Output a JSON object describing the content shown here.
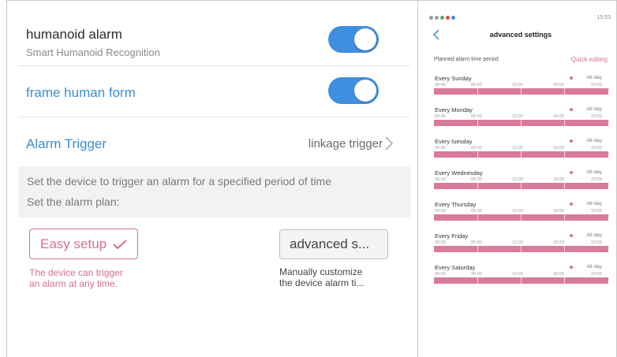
{
  "left": {
    "humanoid_alarm": {
      "title": "humanoid alarm",
      "subtitle": "Smart Humanoid Recognition",
      "enabled": true
    },
    "frame_human_form": {
      "title": "frame human form",
      "enabled": true
    },
    "alarm_trigger": {
      "title": "Alarm Trigger",
      "value": "linkage trigger"
    },
    "info": {
      "line1": "Set the device to trigger an alarm for a specified period of time",
      "line2": "Set the alarm plan:"
    },
    "easy_setup": {
      "label": "Easy setup",
      "desc_line1": "The device can trigger",
      "desc_line2": "an alarm at any time."
    },
    "advanced": {
      "label": "advanced s...",
      "desc_line1": "Manually customize",
      "desc_line2": "the device alarm ti..."
    }
  },
  "phone": {
    "status_time": "15:53",
    "title": "advanced settings",
    "plan_label": "Planned alarm time period",
    "quick_editing": "Quick editing",
    "ticks": [
      "00:00",
      "06:00",
      "12:00",
      "18:00",
      "23:59"
    ],
    "all_day_label": "All day",
    "days": [
      {
        "name": "Every Sunday"
      },
      {
        "name": "Every Monday"
      },
      {
        "name": "Every tuesday"
      },
      {
        "name": "Every Wednesday"
      },
      {
        "name": "Every Thursday"
      },
      {
        "name": "Every Friday"
      },
      {
        "name": "Every Saturday"
      }
    ]
  },
  "colors": {
    "accent_pink": "#d4708f",
    "toggle_blue": "#3f8fe0",
    "label_blue": "#3a8fcf"
  }
}
